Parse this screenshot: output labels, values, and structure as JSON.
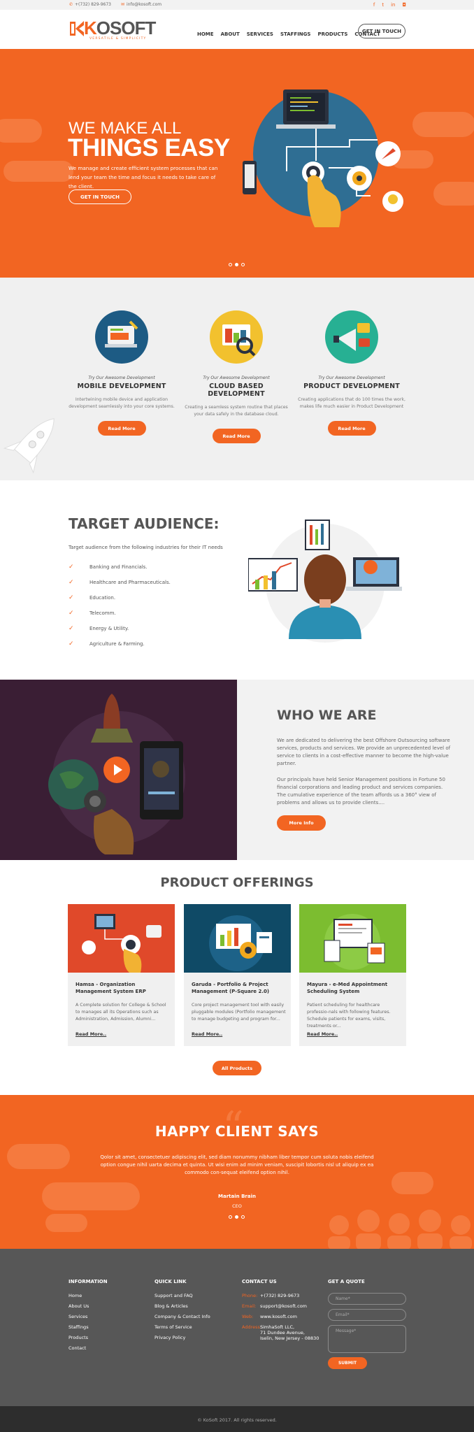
{
  "topbar": {
    "phone": "+(732) 829-9673",
    "email": "info@kosoft.com"
  },
  "logo": {
    "name_k": "K",
    "name_rest": "OSOFT",
    "tagline": "VERSATILE & SIMPLICITY"
  },
  "nav": {
    "items": [
      "HOME",
      "ABOUT",
      "SERVICES",
      "STAFFINGS",
      "PRODUCTS",
      "CONTACT"
    ],
    "cta": "GET IN TOUCH"
  },
  "hero": {
    "line1": "WE MAKE ALL",
    "line2": "THINGS EASY",
    "text": "We manage and create efficient system processes that can lend your team the time and focus it needs to take care of the client.",
    "button": "GET IN TOUCH"
  },
  "services": [
    {
      "pre": "Try Our Awesome Development",
      "title": "MOBILE DEVELOPMENT",
      "text": "Intertwining mobile device and application development seamlessly into your core systems.",
      "button": "Read More"
    },
    {
      "pre": "Try Our Awesome Development",
      "title": "CLOUD BASED DEVELOPMENT",
      "text": "Creating a seamless system routine that places your data safely in the database cloud.",
      "button": "Read More"
    },
    {
      "pre": "Try Our Awesome Development",
      "title": "PRODUCT DEVELOPMENT",
      "text": "Creating applications that do 100 times the work, makes life much easier in Product Development",
      "button": "Read More"
    }
  ],
  "target": {
    "title": "TARGET AUDIENCE:",
    "intro": "Target audience from the following industries for their IT needs",
    "items": [
      "Banking and Financials.",
      "Healthcare and Pharmaceuticals.",
      "Education.",
      "Telecomm.",
      "Energy & Utility.",
      "Agriculture & Farming."
    ]
  },
  "who": {
    "title": "WHO WE ARE",
    "p1": "We are dedicated to delivering the best Offshore Outsourcing software services, products and services. We provide an unprecedented level of service to clients in a cost-effective manner to become the high-value partner.",
    "p2": "Our principals have held Senior Management positions in Fortune 50 financial corporations and leading product and services companies. The cumulative experience of the team affords us a 360° view of problems and allows us to provide clients....",
    "button": "More Info"
  },
  "products": {
    "title": "PRODUCT OFFERINGS",
    "cards": [
      {
        "title": "Hamsa - Organization Management System ERP",
        "text": "A Complete solution for College & School to manages all its Operations such as Administration, Admission, Alumni...",
        "more": "Read More..",
        "color": "#e0492a"
      },
      {
        "title": "Garuda - Portfolio & Project Management (P-Square 2.0)",
        "text": "Core project management tool with easily pluggable modules (Portfolio management to manage budgeting and program for...",
        "more": "Read More..",
        "color": "#0f4a66"
      },
      {
        "title": "Mayura - e-Med Appointment Scheduling System",
        "text": "Patient scheduling for healthcare professio-nals with following features. Schedule patients for exams, visits, treatments or...",
        "more": "Read More..",
        "color": "#7cbd30"
      }
    ],
    "all": "All Products"
  },
  "testimonial": {
    "title": "HAPPY CLIENT SAYS",
    "quote": "Qolor sit amet, consectetuer adipiscing elit, sed diam nonummy nibham liber tempor cum soluta nobis eleifend option congue nihil uarta decima et quinta. Ut wisi enim ad minim veniam, suscipit lobortis nisl ut aliquip ex ea commodo con-sequat eleifend option nihil.",
    "name": "Martain Brain",
    "role": "CEO"
  },
  "footer": {
    "info": {
      "title": "INFORMATION",
      "items": [
        "Home",
        "About Us",
        "Services",
        "Staffings",
        "Products",
        "Contact"
      ]
    },
    "quick": {
      "title": "QUICK LINK",
      "items": [
        "Support and FAQ",
        "Blog & Articles",
        "Company & Contact Info",
        "Terms of Service",
        "Privacy Policy"
      ]
    },
    "contact": {
      "title": "CONTACT US",
      "phone_k": "Phone:",
      "phone": "+(732) 829-9673",
      "email_k": "Email:",
      "email": "support@kosoft.com",
      "web_k": "Web:",
      "web": "www.kosoft.com",
      "addr_k": "Address:",
      "addr1": "SimhaSoft LLC,",
      "addr2": "71 Dundee Avenue,",
      "addr3": "Iselin, New Jersey - 08830"
    },
    "quote": {
      "title": "GET A QUOTE",
      "name": "Name*",
      "email": "Email*",
      "message": "Message*",
      "submit": "SUBMIT"
    }
  },
  "copyright": "© KoSoft 2017. All rights reserved."
}
